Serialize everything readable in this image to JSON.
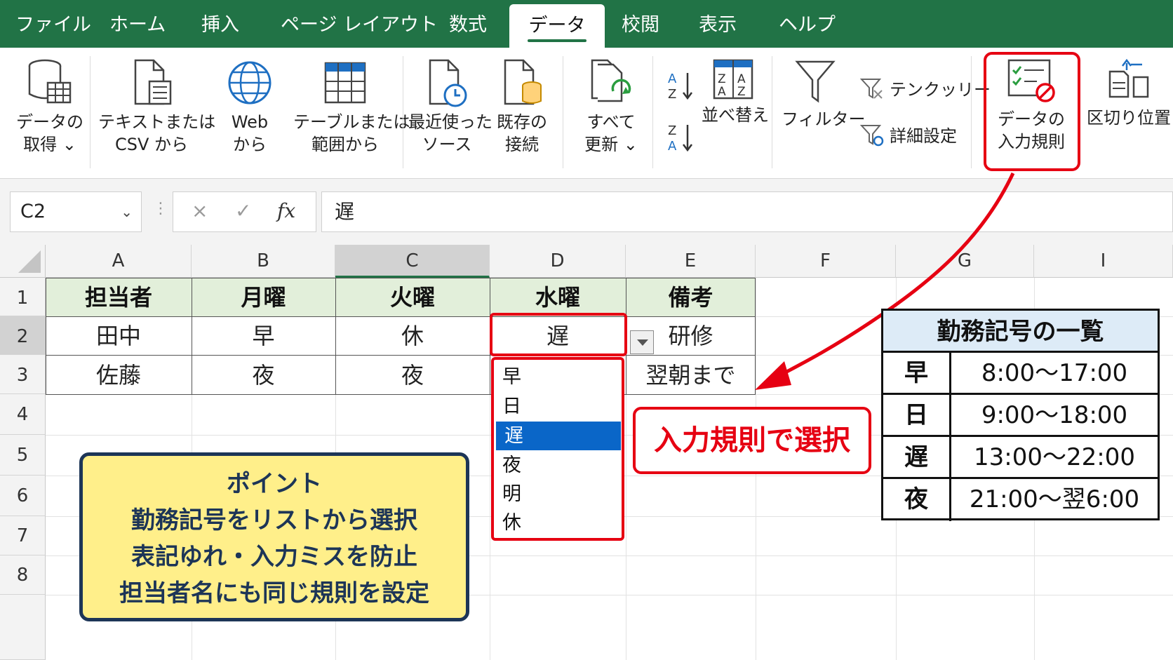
{
  "tabs": [
    {
      "label": "ファイル",
      "active": false
    },
    {
      "label": "ホーム",
      "active": false
    },
    {
      "label": "挿入",
      "active": false
    },
    {
      "label": "ページ レイアウト",
      "active": false
    },
    {
      "label": "数式",
      "active": false
    },
    {
      "label": "データ",
      "active": true
    },
    {
      "label": "校閲",
      "active": false
    },
    {
      "label": "表示",
      "active": false
    },
    {
      "label": "ヘルプ",
      "active": false
    }
  ],
  "ribbon": {
    "get_data": {
      "line1": "データの",
      "line2": "取得 ⌄"
    },
    "text_csv": {
      "line1": "テキストまたは",
      "line2": "CSV から"
    },
    "web": {
      "line1": "Web",
      "line2": "から"
    },
    "table_range": {
      "line1": "テーブルまたは",
      "line2": "範囲から"
    },
    "recent_sources": {
      "line1": "最近使った",
      "line2": "ソース"
    },
    "existing_connections": {
      "line1": "既存の",
      "line2": "接続"
    },
    "refresh_all": {
      "line1": "すべて",
      "line2": "更新 ⌄"
    },
    "sort_label": "並べ替え",
    "filter_label": "フィルター",
    "clear_label": "テンクッリー",
    "advanced_label": "詳細設定",
    "data_validation": {
      "line1": "データの",
      "line2": "入力規則"
    },
    "text_to_columns": "区切り位置"
  },
  "formula_bar": {
    "name_box": "C2",
    "cancel": "×",
    "enter": "✓",
    "fx": "fx",
    "value": "遅"
  },
  "columns": [
    "A",
    "B",
    "C",
    "D",
    "E",
    "F",
    "G",
    "I"
  ],
  "rows": [
    "1",
    "2",
    "3",
    "4",
    "5",
    "6",
    "7",
    "8"
  ],
  "table": {
    "headers": [
      "担当者",
      "月曜",
      "火曜",
      "水曜",
      "備考"
    ],
    "rows": [
      [
        "田中",
        "早",
        "休",
        "遅",
        "研修"
      ],
      [
        "佐藤",
        "夜",
        "夜",
        "",
        "翌朝まで"
      ]
    ]
  },
  "dropdown": {
    "options": [
      "早",
      "日",
      "遅",
      "夜",
      "明",
      "休"
    ],
    "selected_index": 2
  },
  "callout": "入力規則で選択",
  "point_box": {
    "lines": [
      "ポイント",
      "勤務記号をリストから選択",
      "表記ゆれ・入力ミスを防止",
      "担当者名にも同じ規則を設定"
    ]
  },
  "legend": {
    "title": "勤務記号の一覧",
    "rows": [
      {
        "key": "早",
        "value": "8:00～17:00"
      },
      {
        "key": "日",
        "value": "9:00～18:00"
      },
      {
        "key": "遅",
        "value": "13:00～22:00"
      },
      {
        "key": "夜",
        "value": "21:00～翌6:00"
      }
    ]
  },
  "colors": {
    "excel_green": "#217346",
    "header_fill": "#e2efda",
    "highlight_red": "#e60012",
    "selected_blue": "#0a66c8",
    "point_fill": "#ffef8a",
    "legend_header": "#ddebf7"
  }
}
